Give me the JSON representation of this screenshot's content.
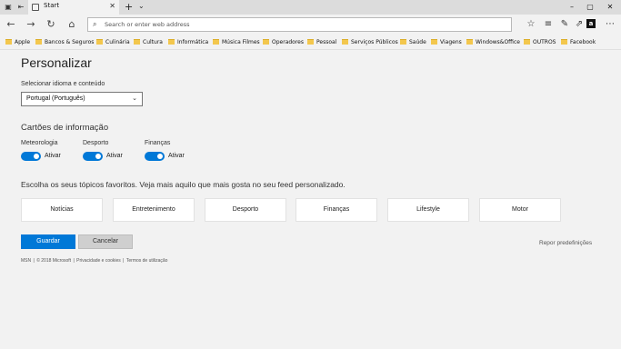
{
  "browser": {
    "tab_title": "Start",
    "tab_close": "✕",
    "new_tab": "+",
    "tab_list": "⌄",
    "address_placeholder": "Search or enter web address",
    "minimize": "–",
    "maximize": "▢",
    "close": "✕"
  },
  "favorites": [
    "Apple",
    "Bancos & Seguros",
    "Culinária",
    "Cultura",
    "Informática",
    "Música Filmes",
    "Operadores",
    "Pessoal",
    "Serviços Públicos",
    "Saúde",
    "Viagens",
    "Windows&Office",
    "OUTROS",
    "Facebook"
  ],
  "page": {
    "title": "Personalizar",
    "language_label": "Selecionar idioma e conteúdo",
    "language_value": "Portugal (Português)",
    "info_cards_heading": "Cartões de informação",
    "toggles": [
      {
        "label": "Meteorologia",
        "state": "Ativar",
        "on": true
      },
      {
        "label": "Desporto",
        "state": "Ativar",
        "on": true
      },
      {
        "label": "Finanças",
        "state": "Ativar",
        "on": true
      }
    ],
    "topics_intro": "Escolha os seus tópicos favoritos. Veja mais aquilo que mais gosta no seu feed personalizado.",
    "topics": [
      "Notícias",
      "Entretenimento",
      "Desporto",
      "Finanças",
      "Lifestyle",
      "Motor"
    ],
    "save_label": "Guardar",
    "cancel_label": "Cancelar",
    "reset_label": "Repor predefinições",
    "footer": {
      "msn": "MSN",
      "copyright": "© 2018 Microsoft",
      "privacy": "Privacidade e cookies",
      "terms": "Termos de utilização"
    }
  },
  "colors": {
    "accent": "#0078d7",
    "folder": "#f3c74d"
  }
}
